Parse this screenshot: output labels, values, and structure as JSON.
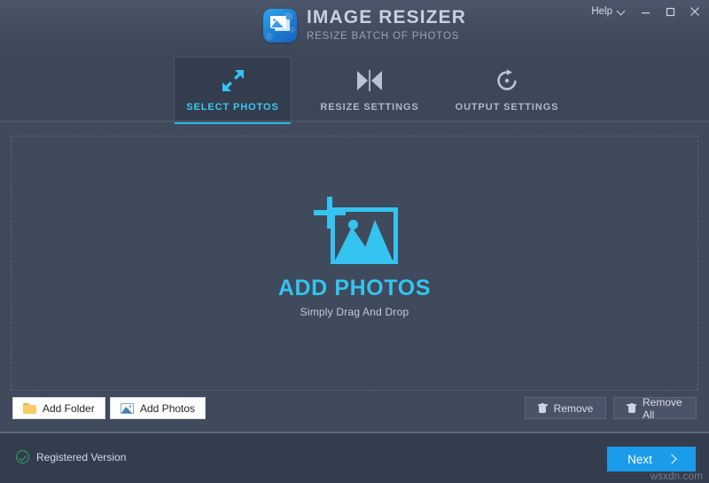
{
  "window": {
    "help_label": "Help",
    "help_chevron_icon": "chevron-down-icon",
    "minimize_icon": "minimize-icon",
    "maximize_icon": "maximize-icon",
    "close_icon": "close-icon"
  },
  "brand": {
    "logo_icon": "image-resizer-app-icon",
    "title": "IMAGE RESIZER",
    "subtitle": "RESIZE BATCH OF PHOTOS"
  },
  "tabs": [
    {
      "id": "select-photos",
      "label": "SELECT PHOTOS",
      "icon": "resize-arrows-icon",
      "active": true
    },
    {
      "id": "resize-settings",
      "label": "RESIZE SETTINGS",
      "icon": "compress-horizontal-icon",
      "active": false
    },
    {
      "id": "output-settings",
      "label": "OUTPUT SETTINGS",
      "icon": "refresh-clockwise-icon",
      "active": false
    }
  ],
  "dropzone": {
    "icon": "add-photo-icon",
    "title": "ADD PHOTOS",
    "subtitle": "Simply Drag And Drop"
  },
  "actions": {
    "add_folder": {
      "label": "Add Folder",
      "icon": "folder-icon"
    },
    "add_photos": {
      "label": "Add Photos",
      "icon": "photo-icon"
    },
    "remove": {
      "label": "Remove",
      "icon": "trash-icon"
    },
    "remove_all": {
      "label": "Remove All",
      "icon": "trash-icon"
    }
  },
  "footer": {
    "status_icon": "check-circle-icon",
    "status_label": "Registered Version",
    "next_label": "Next",
    "next_icon": "chevron-right-icon",
    "watermark": "wsxdn.com"
  },
  "colors": {
    "accent_cyan": "#35c3f0",
    "accent_blue": "#1b9ceb",
    "header_bg": "#4c566a",
    "body_bg": "#3f4a5c",
    "footer_bg": "#333d4e",
    "status_green": "#2fa862"
  }
}
